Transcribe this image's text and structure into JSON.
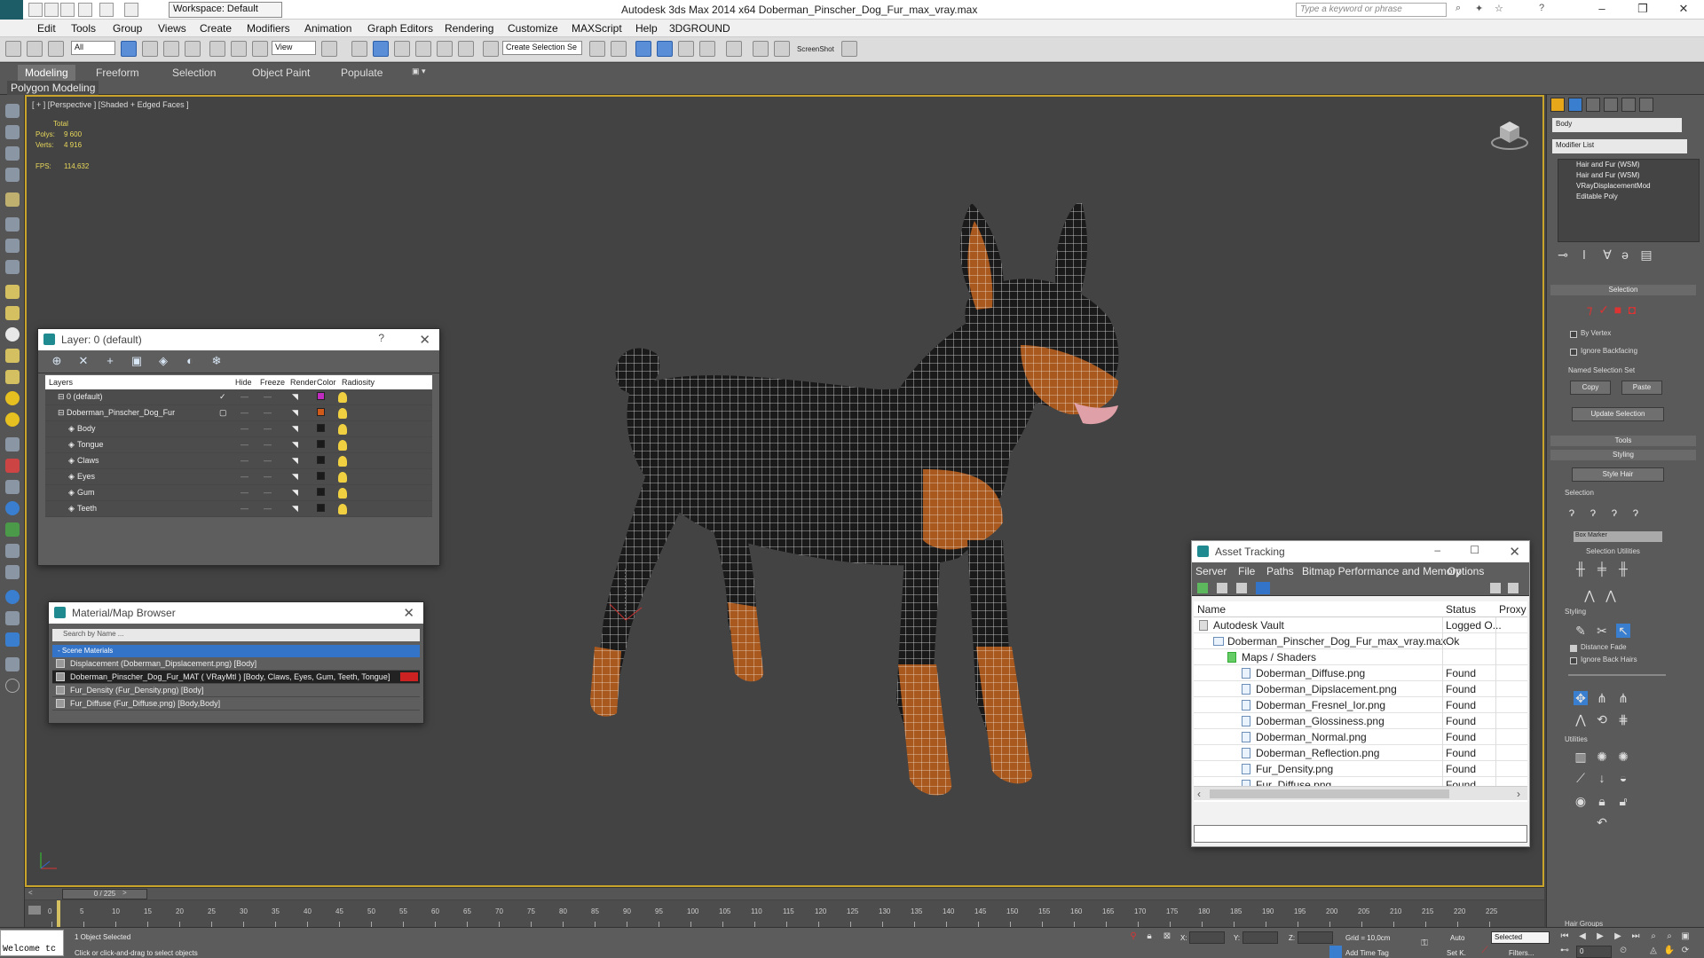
{
  "window": {
    "title": "Autodesk 3ds Max  2014 x64    Doberman_Pinscher_Dog_Fur_max_vray.max",
    "workspace": "Workspace: Default",
    "search_placeholder": "Type a keyword or phrase"
  },
  "menu": [
    "Edit",
    "Tools",
    "Group",
    "Views",
    "Create",
    "Modifiers",
    "Animation",
    "Graph Editors",
    "Rendering",
    "Customize",
    "MAXScript",
    "Help",
    "3DGROUND"
  ],
  "toolbar": {
    "filter": "All",
    "ref_coord": "View",
    "named_selection": "Create Selection Se",
    "screenshot": "ScreenShot"
  },
  "ribbon": {
    "tabs": [
      "Modeling",
      "Freeform",
      "Selection",
      "Object Paint",
      "Populate"
    ],
    "active_tab": "Modeling",
    "subtitle": "Polygon Modeling"
  },
  "viewport": {
    "label": "[ + ] [Perspective ] [Shaded + Edged Faces ]",
    "stats": {
      "total_label": "Total",
      "polys_label": "Polys:",
      "polys": "9 600",
      "verts_label": "Verts:",
      "verts": "4 916",
      "fps_label": "FPS:",
      "fps": "114,632"
    }
  },
  "layer_window": {
    "title": "Layer: 0 (default)",
    "columns": [
      "Layers",
      "Hide",
      "Freeze",
      "Render",
      "Color",
      "Radiosity"
    ],
    "rows": [
      {
        "name": "0 (default)",
        "indent": 1,
        "color": "#c02cc0",
        "check": "✓"
      },
      {
        "name": "Doberman_Pinscher_Dog_Fur",
        "indent": 1,
        "color": "#d05a1a",
        "check": "▢"
      },
      {
        "name": "Body",
        "indent": 2,
        "color": "#1a1a1a",
        "check": ""
      },
      {
        "name": "Tongue",
        "indent": 2,
        "color": "#1a1a1a",
        "check": ""
      },
      {
        "name": "Claws",
        "indent": 2,
        "color": "#1a1a1a",
        "check": ""
      },
      {
        "name": "Eyes",
        "indent": 2,
        "color": "#1a1a1a",
        "check": ""
      },
      {
        "name": "Gum",
        "indent": 2,
        "color": "#1a1a1a",
        "check": ""
      },
      {
        "name": "Teeth",
        "indent": 2,
        "color": "#1a1a1a",
        "check": ""
      }
    ]
  },
  "material_browser": {
    "title": "Material/Map Browser",
    "search_placeholder": "Search by Name ...",
    "group": "- Scene Materials",
    "items": [
      "Displacement (Doberman_Dipslacement.png) [Body]",
      "Doberman_Pinscher_Dog_Fur_MAT ( VRayMtl ) [Body, Claws, Eyes, Gum, Teeth, Tongue]",
      "Fur_Density (Fur_Density.png) [Body]",
      "Fur_Diffuse (Fur_Diffuse.png) [Body,Body]"
    ],
    "selected_index": 1
  },
  "asset_tracking": {
    "title": "Asset Tracking",
    "menu": [
      "Server",
      "File",
      "Paths",
      "Bitmap Performance and Memory",
      "Options"
    ],
    "columns": [
      "Name",
      "Status",
      "Proxy"
    ],
    "rows": [
      {
        "name": "Autodesk Vault",
        "status": "Logged O...",
        "level": 0
      },
      {
        "name": "Doberman_Pinscher_Dog_Fur_max_vray.max",
        "status": "Ok",
        "level": 1
      },
      {
        "name": "Maps / Shaders",
        "status": "",
        "level": 2
      },
      {
        "name": "Doberman_Diffuse.png",
        "status": "Found",
        "level": 3
      },
      {
        "name": "Doberman_Dipslacement.png",
        "status": "Found",
        "level": 3
      },
      {
        "name": "Doberman_Fresnel_Ior.png",
        "status": "Found",
        "level": 3
      },
      {
        "name": "Doberman_Glossiness.png",
        "status": "Found",
        "level": 3
      },
      {
        "name": "Doberman_Normal.png",
        "status": "Found",
        "level": 3
      },
      {
        "name": "Doberman_Reflection.png",
        "status": "Found",
        "level": 3
      },
      {
        "name": "Fur_Density.png",
        "status": "Found",
        "level": 3
      },
      {
        "name": "Fur_Diffuse.png",
        "status": "Found",
        "level": 3
      }
    ]
  },
  "command_panel": {
    "object_name": "Body",
    "modifier_list": "Modifier List",
    "stack": [
      "Hair and Fur (WSM)",
      "Hair and Fur (WSM)",
      "VRayDisplacementMod",
      "Editable Poly"
    ],
    "selection_title": "Selection",
    "by_vertex": "By Vertex",
    "ignore_backfacing": "Ignore Backfacing",
    "named_selection_set": "Named Selection Set",
    "copy": "Copy",
    "paste": "Paste",
    "update_selection": "Update Selection",
    "tools": "Tools",
    "styling": "Styling",
    "style_hair": "Style Hair",
    "sub_selection": "Selection",
    "box_marker": "Box Marker",
    "selection_utilities": "Selection Utilities",
    "sub_styling": "Styling",
    "distance_fade": "Distance Fade",
    "ignore_back_hairs": "Ignore Back Hairs",
    "utilities": "Utilities",
    "hair_groups": "Hair Groups"
  },
  "timeline": {
    "slider": "0 / 225",
    "ticks": [
      "0",
      "5",
      "10",
      "15",
      "20",
      "25",
      "30",
      "35",
      "40",
      "45",
      "50",
      "55",
      "60",
      "65",
      "70",
      "75",
      "80",
      "85",
      "90",
      "95",
      "100",
      "105",
      "110",
      "115",
      "120",
      "125",
      "130",
      "135",
      "140",
      "145",
      "150",
      "155",
      "160",
      "165",
      "170",
      "175",
      "180",
      "185",
      "190",
      "195",
      "200",
      "205",
      "210",
      "215",
      "220",
      "225"
    ]
  },
  "status": {
    "welcome": "Welcome tc",
    "objects_selected": "1 Object Selected",
    "prompt": "Click or click-and-drag to select objects",
    "x_label": "X:",
    "y_label": "Y:",
    "z_label": "Z:",
    "grid": "Grid = 10,0cm",
    "add_time_tag": "Add Time Tag",
    "auto": "Auto",
    "set_key": "Set K.",
    "selected": "Selected",
    "filters": "Filters...",
    "frame": "0"
  }
}
